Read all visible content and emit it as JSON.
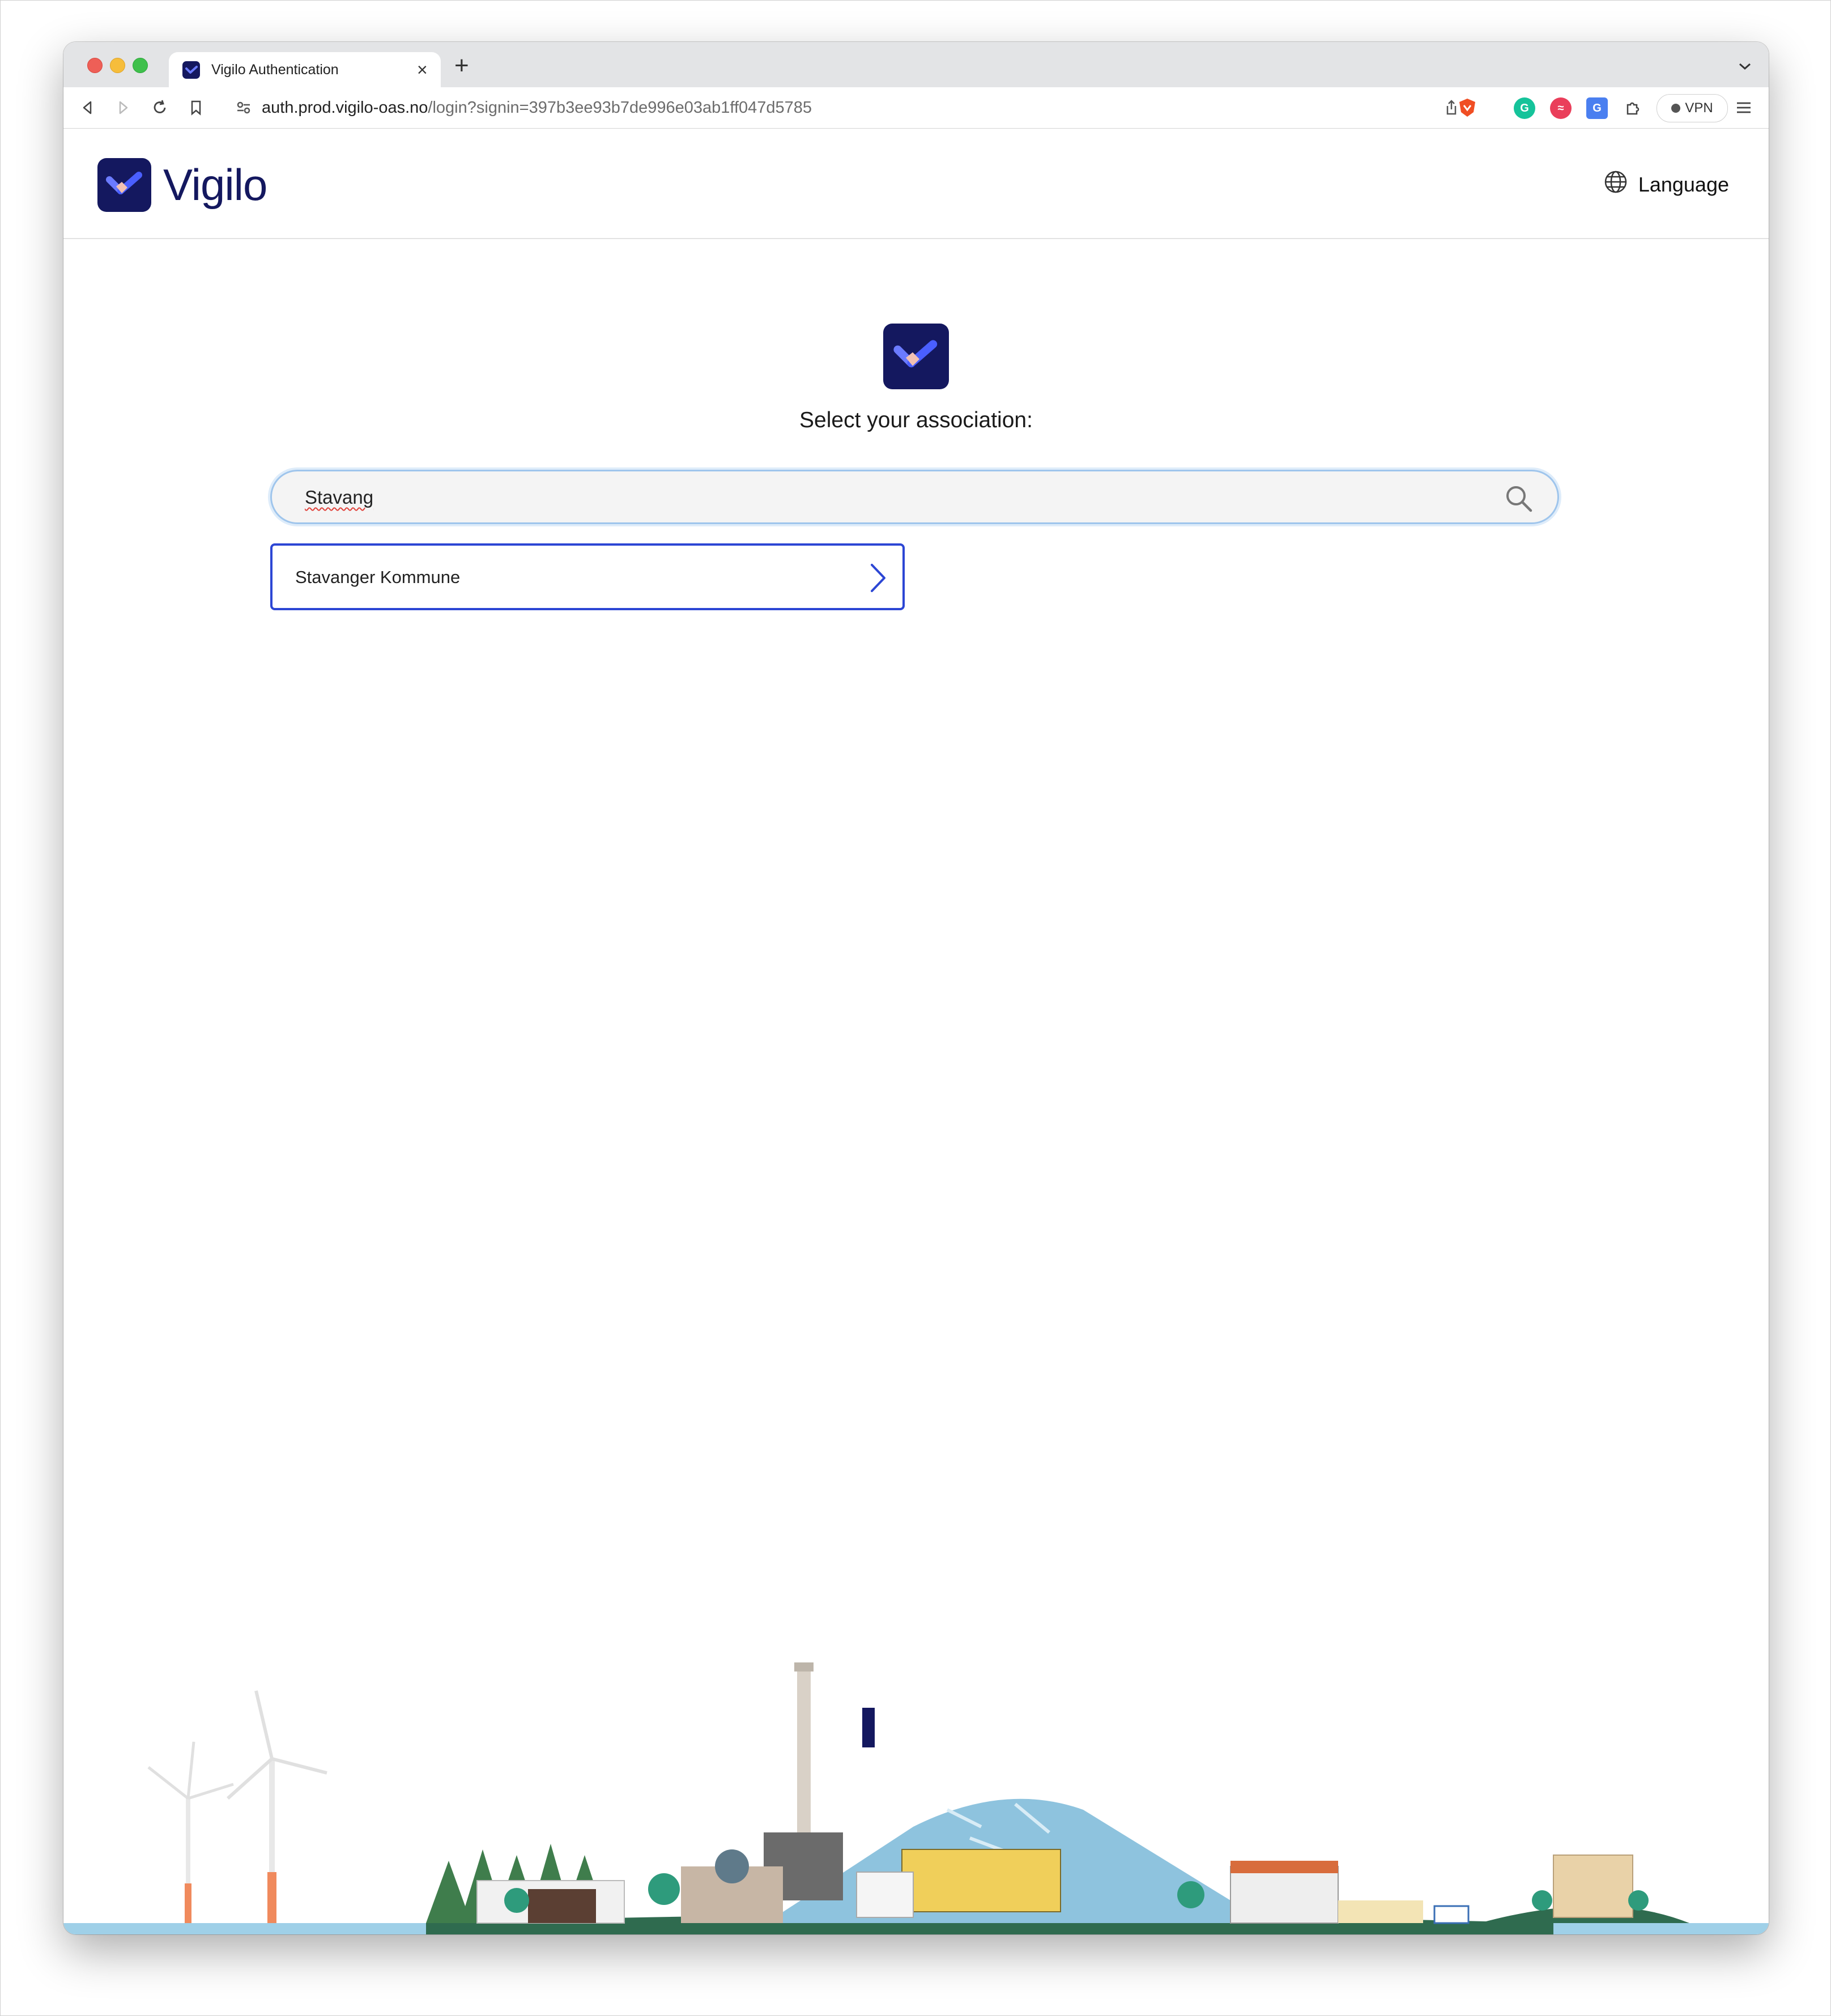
{
  "browser": {
    "tab_title": "Vigilo Authentication",
    "url_host": "auth.prod.vigilo-oas.no",
    "url_path": "/login?signin=397b3ee93b7de996e03ab1ff047d5785",
    "vpn_label": "VPN"
  },
  "header": {
    "brand": "Vigilo",
    "language_label": "Language"
  },
  "main": {
    "heading": "Select your association:",
    "search": {
      "value": "Stavang"
    },
    "results": [
      {
        "label": "Stavanger Kommune"
      }
    ]
  },
  "colors": {
    "brand": "#14185f",
    "accent": "#2c46d4",
    "search_focus": "#9fc5ec"
  },
  "icons": [
    "close-icon",
    "plus-icon",
    "back-icon",
    "forward-icon",
    "reload-icon",
    "bookmark-icon",
    "site-settings-icon",
    "share-icon",
    "brave-shield-icon",
    "grammarly-icon",
    "extension-icon",
    "translate-icon",
    "puzzle-icon",
    "menu-icon",
    "globe-icon",
    "search-icon",
    "chevron-right-icon"
  ]
}
